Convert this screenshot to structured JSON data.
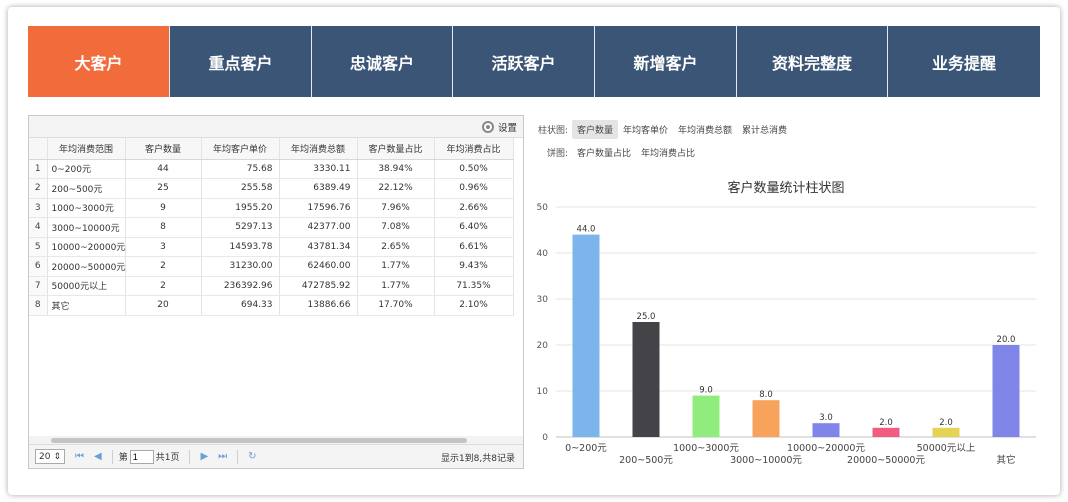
{
  "tabs": [
    {
      "label": "大客户",
      "active": true
    },
    {
      "label": "重点客户",
      "active": false
    },
    {
      "label": "忠诚客户",
      "active": false
    },
    {
      "label": "活跃客户",
      "active": false
    },
    {
      "label": "新增客户",
      "active": false
    },
    {
      "label": "资料完整度",
      "active": false
    },
    {
      "label": "业务提醒",
      "active": false
    }
  ],
  "grid": {
    "settings_label": "设置",
    "columns": [
      "年均消费范围",
      "客户数量",
      "年均客户单价",
      "年均消费总额",
      "客户数量占比",
      "年均消费占比"
    ],
    "rows": [
      [
        "1",
        "0~200元",
        "44",
        "75.68",
        "3330.11",
        "38.94%",
        "0.50%"
      ],
      [
        "2",
        "200~500元",
        "25",
        "255.58",
        "6389.49",
        "22.12%",
        "0.96%"
      ],
      [
        "3",
        "1000~3000元",
        "9",
        "1955.20",
        "17596.76",
        "7.96%",
        "2.66%"
      ],
      [
        "4",
        "3000~10000元",
        "8",
        "5297.13",
        "42377.00",
        "7.08%",
        "6.40%"
      ],
      [
        "5",
        "10000~20000元",
        "3",
        "14593.78",
        "43781.34",
        "2.65%",
        "6.61%"
      ],
      [
        "6",
        "20000~50000元",
        "2",
        "31230.00",
        "62460.00",
        "1.77%",
        "9.43%"
      ],
      [
        "7",
        "50000元以上",
        "2",
        "236392.96",
        "472785.92",
        "1.77%",
        "71.35%"
      ],
      [
        "8",
        "其它",
        "20",
        "694.33",
        "13886.66",
        "17.70%",
        "2.10%"
      ]
    ],
    "pager": {
      "page_size": "20",
      "page_prefix": "第",
      "page_value": "1",
      "page_total": "共1页",
      "info": "显示1到8,共8记录"
    }
  },
  "chart_types": {
    "bar_label": "柱状图:",
    "bar_options": [
      "客户数量",
      "年均客单价",
      "年均消费总额",
      "累计总消费"
    ],
    "bar_selected": 0,
    "pie_label": "饼图:",
    "pie_options": [
      "客户数量占比",
      "年均消费占比"
    ]
  },
  "chart_data": {
    "type": "bar",
    "title": "客户数量统计柱状图",
    "categories": [
      "0~200元",
      "200~500元",
      "1000~3000元",
      "3000~10000元",
      "10000~20000元",
      "20000~50000元",
      "50000元以上",
      "其它"
    ],
    "values": [
      44,
      25,
      9,
      8,
      3,
      2,
      2,
      20
    ],
    "value_labels": [
      "44.0",
      "25.0",
      "9.0",
      "8.0",
      "3.0",
      "2.0",
      "2.0",
      "20.0"
    ],
    "colors": [
      "#7cb5ec",
      "#434348",
      "#90ed7d",
      "#f7a35c",
      "#8085e9",
      "#f15c80",
      "#e4d354",
      "#8085e8"
    ],
    "ylim": [
      0,
      50
    ],
    "yticks": [
      "0",
      "10",
      "20",
      "30",
      "40",
      "50"
    ],
    "grid": true,
    "legend": "none",
    "xlabel": "",
    "ylabel": ""
  }
}
